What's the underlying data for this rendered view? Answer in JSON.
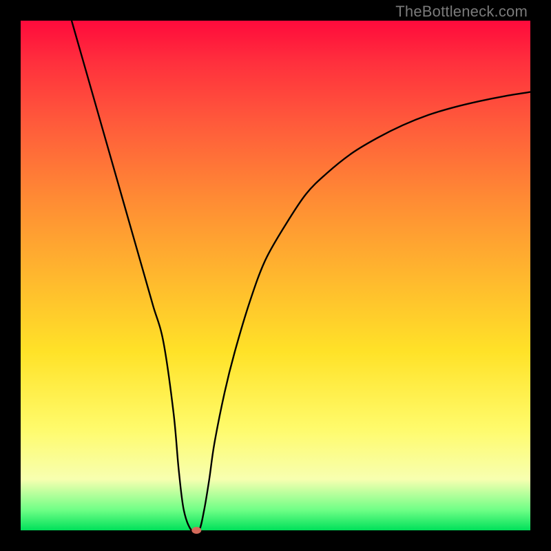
{
  "watermark": "TheBottleneck.com",
  "chart_data": {
    "type": "line",
    "title": "",
    "xlabel": "",
    "ylabel": "",
    "xlim": [
      0,
      100
    ],
    "ylim": [
      0,
      100
    ],
    "series": [
      {
        "name": "curve",
        "x": [
          10,
          12,
          14,
          16,
          18,
          20,
          22,
          24,
          26,
          28,
          30,
          31,
          32,
          33.5,
          35,
          36,
          37,
          38,
          40,
          42,
          45,
          48,
          52,
          56,
          60,
          65,
          70,
          75,
          80,
          85,
          90,
          95,
          100
        ],
        "y": [
          100,
          93,
          86,
          79,
          72,
          65,
          58,
          51,
          44,
          37,
          23,
          12,
          4,
          0,
          0,
          4,
          10,
          17,
          27,
          35,
          45,
          53,
          60,
          66,
          70,
          74,
          77,
          79.5,
          81.5,
          83,
          84.2,
          85.2,
          86
        ]
      }
    ],
    "marker": {
      "x": 34.5,
      "y": 0,
      "color": "#d46a5a",
      "rx": 7,
      "ry": 5
    },
    "gradient_stops": [
      {
        "pos": 0,
        "color": "#ff0a3c"
      },
      {
        "pos": 8,
        "color": "#ff2f3d"
      },
      {
        "pos": 20,
        "color": "#ff5a3b"
      },
      {
        "pos": 35,
        "color": "#ff8b34"
      },
      {
        "pos": 50,
        "color": "#ffb72e"
      },
      {
        "pos": 65,
        "color": "#ffe228"
      },
      {
        "pos": 80,
        "color": "#fffb6b"
      },
      {
        "pos": 90,
        "color": "#f7ffb0"
      },
      {
        "pos": 96,
        "color": "#6fff86"
      },
      {
        "pos": 100,
        "color": "#00e05a"
      }
    ]
  }
}
